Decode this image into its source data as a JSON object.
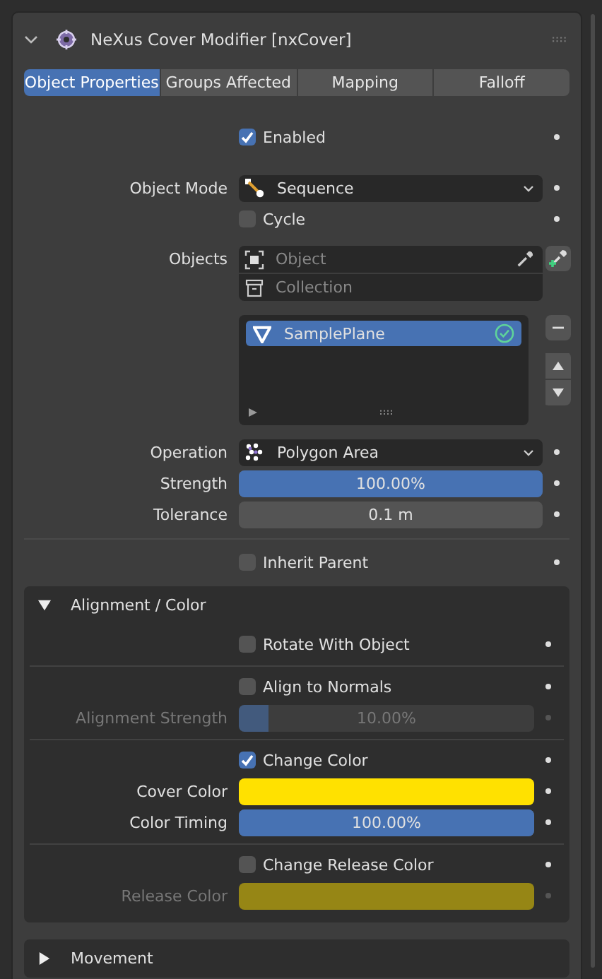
{
  "panel": {
    "title": "NeXus Cover Modifier [nxCover]",
    "expanded": true
  },
  "tabs": [
    {
      "label": "Object Properties",
      "selected": true
    },
    {
      "label": "Groups Affected",
      "selected": false
    },
    {
      "label": "Mapping",
      "selected": false
    },
    {
      "label": "Falloff",
      "selected": false
    }
  ],
  "enabled": {
    "label": "Enabled",
    "checked": true
  },
  "object_mode": {
    "label": "Object Mode",
    "value": "Sequence"
  },
  "cycle": {
    "label": "Cycle",
    "checked": false
  },
  "objects": {
    "label": "Objects",
    "object_placeholder": "Object",
    "collection_placeholder": "Collection",
    "items": [
      {
        "name": "SamplePlane",
        "selected": true
      }
    ]
  },
  "operation": {
    "label": "Operation",
    "value": "Polygon Area"
  },
  "strength": {
    "label": "Strength",
    "level": 1,
    "reading": "100.00%"
  },
  "tolerance": {
    "label": "Tolerance",
    "value": "0.1 m"
  },
  "inherit_parent": {
    "label": "Inherit Parent",
    "checked": false
  },
  "subpanels": [
    {
      "title": "Alignment / Color",
      "expanded": true,
      "groups": [
        [
          {
            "kind": "checkbox",
            "label": "Rotate With Object",
            "checked": false,
            "disabled": false
          }
        ],
        [
          {
            "kind": "checkbox",
            "label": "Align to Normals",
            "checked": false,
            "disabled": false
          },
          {
            "kind": "slider",
            "label": "Alignment Strength",
            "level": 0.1,
            "reading": "10.00%",
            "disabled": true
          }
        ],
        [
          {
            "kind": "checkbox",
            "label": "Change Color",
            "checked": true,
            "disabled": false
          },
          {
            "kind": "color",
            "label": "Cover Color",
            "color": "#ffe100",
            "disabled": false
          },
          {
            "kind": "slider",
            "label": "Color Timing",
            "level": 1,
            "reading": "100.00%",
            "disabled": false
          }
        ],
        [
          {
            "kind": "checkbox",
            "label": "Change Release Color",
            "checked": false,
            "disabled": false
          },
          {
            "kind": "color",
            "label": "Release Color",
            "color": "#968615",
            "disabled": true
          }
        ]
      ]
    },
    {
      "title": "Movement",
      "expanded": false
    }
  ]
}
